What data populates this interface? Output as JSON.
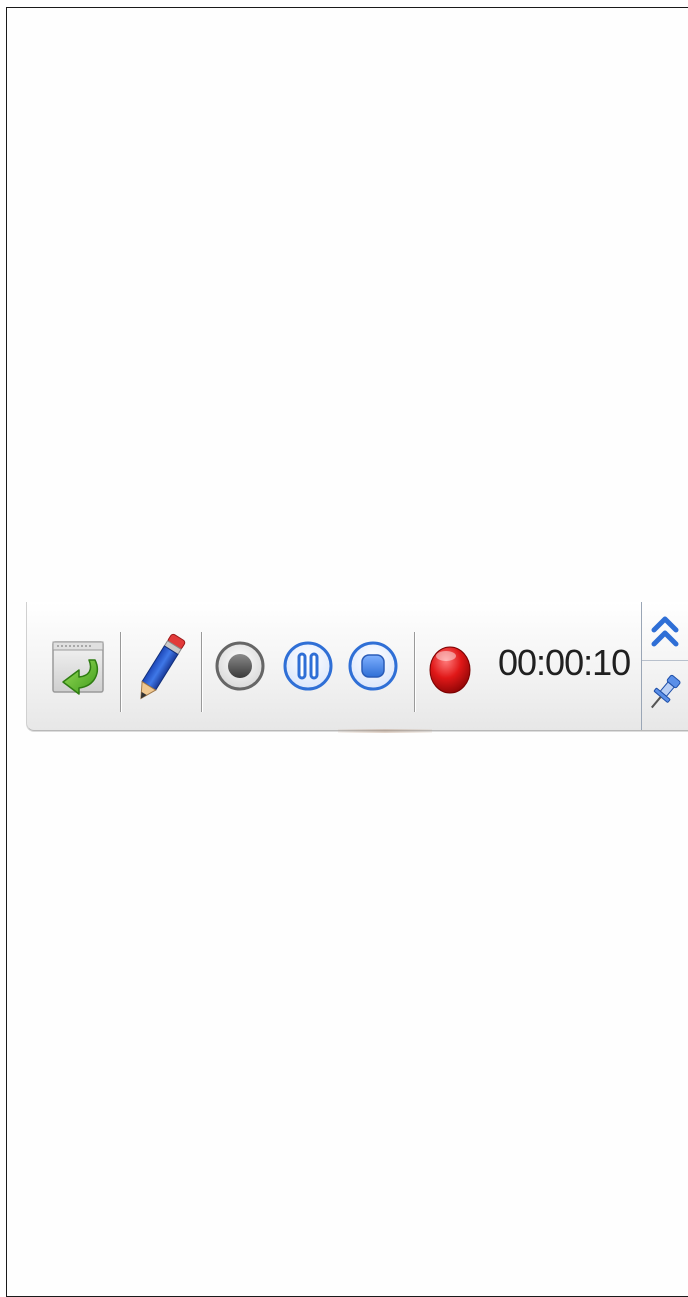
{
  "toolbar": {
    "timer": "00:00:10",
    "colors": {
      "record_red": "#d81010",
      "blue_accent": "#2f6fd6",
      "gray_record": "#555555",
      "arrow_green": "#5cb82e"
    },
    "icons": [
      "return-window-icon",
      "pencil-icon",
      "record-button-icon",
      "pause-button-icon",
      "stop-button-icon",
      "recording-indicator-icon",
      "double-chevron-up-icon",
      "pin-icon"
    ]
  }
}
